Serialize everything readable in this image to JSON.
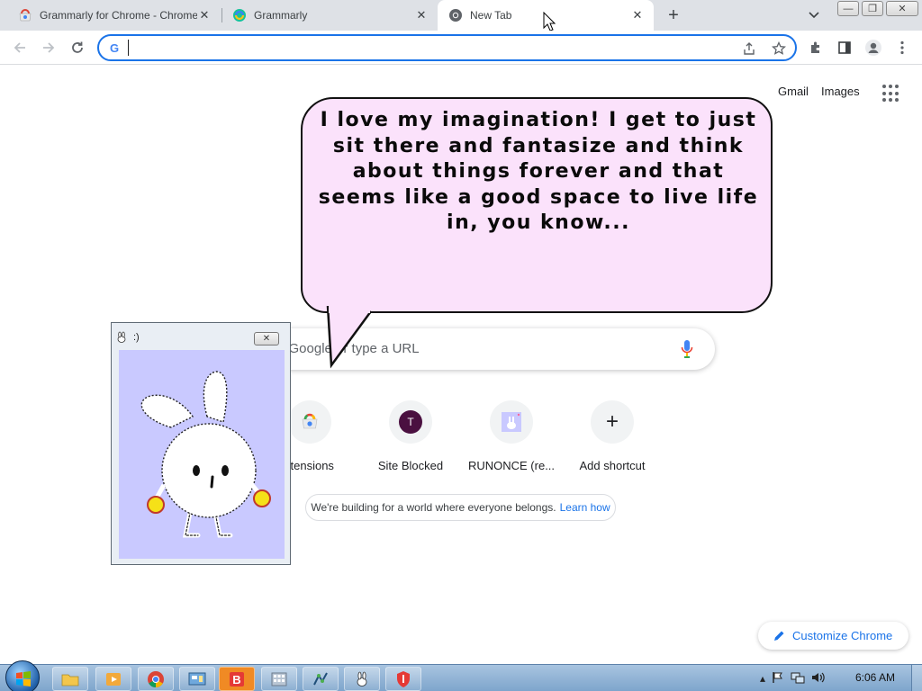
{
  "browser": {
    "tabs": [
      {
        "title": "Grammarly for Chrome - Chrome",
        "favicon": "chrome-webstore-icon",
        "active": false
      },
      {
        "title": "Grammarly",
        "favicon": "grammarly-icon",
        "active": false
      },
      {
        "title": "New Tab",
        "favicon": "chrome-icon",
        "active": true
      }
    ],
    "tab_close_glyph": "✕",
    "new_tab_glyph": "+",
    "window_buttons": {
      "minimize": "—",
      "restore": "❐",
      "close": "✕"
    },
    "omnibox": {
      "value": "",
      "placeholder": "",
      "search_engine_icon": "google-g-icon",
      "g_glyph": "G"
    }
  },
  "ntp": {
    "header_links": {
      "gmail": "Gmail",
      "images": "Images"
    },
    "search": {
      "placeholder": "h Google or type a URL"
    },
    "shortcuts": [
      {
        "label": "Extensions",
        "visible_label": "xtensions",
        "icon": "chrome-webstore-icon"
      },
      {
        "label": "Site Blocked",
        "icon": "letter-avatar-icon",
        "letter": "T"
      },
      {
        "label": "RUNONCE (re...",
        "icon": "runonce-icon"
      },
      {
        "label": "Add shortcut",
        "icon": "plus-icon",
        "glyph": "+"
      }
    ],
    "info_pill": {
      "text": "We're building for a world where everyone belongs.",
      "link": "Learn how"
    },
    "customize_label": "Customize Chrome"
  },
  "speech_bubble": {
    "text": "I love my imagination! I get to just sit there and fantasize and think about things forever and that seems like a good space to live life in, you know..."
  },
  "buddy_window": {
    "title": ":)",
    "close_glyph": "✕",
    "character": "white-bunny-character"
  },
  "taskbar": {
    "apps": [
      "file-explorer-icon",
      "media-player-icon",
      "chrome-icon",
      "control-panel-icon",
      "brave-b-icon",
      "calculator-icon",
      "network-app-icon",
      "bunny-app-icon",
      "shield-app-icon"
    ],
    "clock": "6:06 AM"
  },
  "colors": {
    "accent": "#1a73e8",
    "tabstrip": "#dee1e6",
    "bubble_fill": "#fbe2fb",
    "buddy_canvas": "#c9c9ff",
    "site_blocked_avatar": "#4a1040"
  }
}
